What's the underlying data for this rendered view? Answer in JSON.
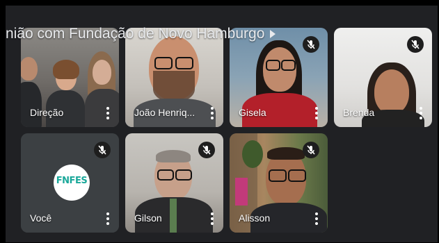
{
  "meeting": {
    "title": "nião com Fundação de Novo Hamburgo"
  },
  "participants": [
    {
      "name": "Direção",
      "muted": false,
      "active": false
    },
    {
      "name": "João Henriq...",
      "muted": false,
      "active": true
    },
    {
      "name": "Gisela",
      "muted": true,
      "active": false
    },
    {
      "name": "Brenda",
      "muted": true,
      "active": false
    },
    {
      "name": "Você",
      "muted": true,
      "active": false,
      "logo_text": "FNFES"
    },
    {
      "name": "Gilson",
      "muted": true,
      "active": false
    },
    {
      "name": "Alisson",
      "muted": true,
      "active": false
    }
  ],
  "icons": {
    "mute": "mic-off-icon",
    "more": "more-vert-icon",
    "title_arrow": "chevron-right-icon"
  },
  "colors": {
    "stage_bg": "#202124",
    "active_border": "#a8c7fa",
    "logo_accent": "#1aa89a"
  }
}
